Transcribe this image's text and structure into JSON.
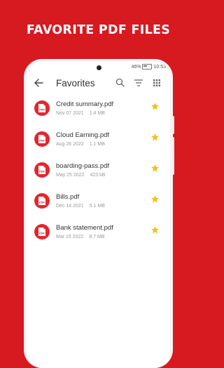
{
  "promo": {
    "headline": "FAVORITE PDF FILES"
  },
  "status_bar": {
    "battery": "46%",
    "time": "10:53"
  },
  "toolbar": {
    "title": "Favorites"
  },
  "icons": {
    "back": "arrow-back-icon",
    "search": "search-icon",
    "sort": "sort-icon",
    "view": "grid-view-icon",
    "file": "pdf-file-icon",
    "favorite": "star-icon"
  },
  "colors": {
    "brand_red": "#d71920",
    "file_icon_red": "#e3262c",
    "star_gold": "#f2c21a"
  },
  "files": [
    {
      "name": "Credit summary.pdf",
      "date": "Nov 07 2021",
      "size": "1.4 MB",
      "favorite": true
    },
    {
      "name": "Cloud Earning.pdf",
      "date": "Aug 26 2022",
      "size": "1.1 MB",
      "favorite": true
    },
    {
      "name": "boarding-pass.pdf",
      "date": "May 25 2022",
      "size": "423 kB",
      "favorite": true
    },
    {
      "name": "Bills.pdf",
      "date": "Dec 14 2021",
      "size": "5.1 MB",
      "favorite": true
    },
    {
      "name": "Bank statement.pdf",
      "date": "Mar 15 2022",
      "size": "8.7 MB",
      "favorite": true
    }
  ]
}
